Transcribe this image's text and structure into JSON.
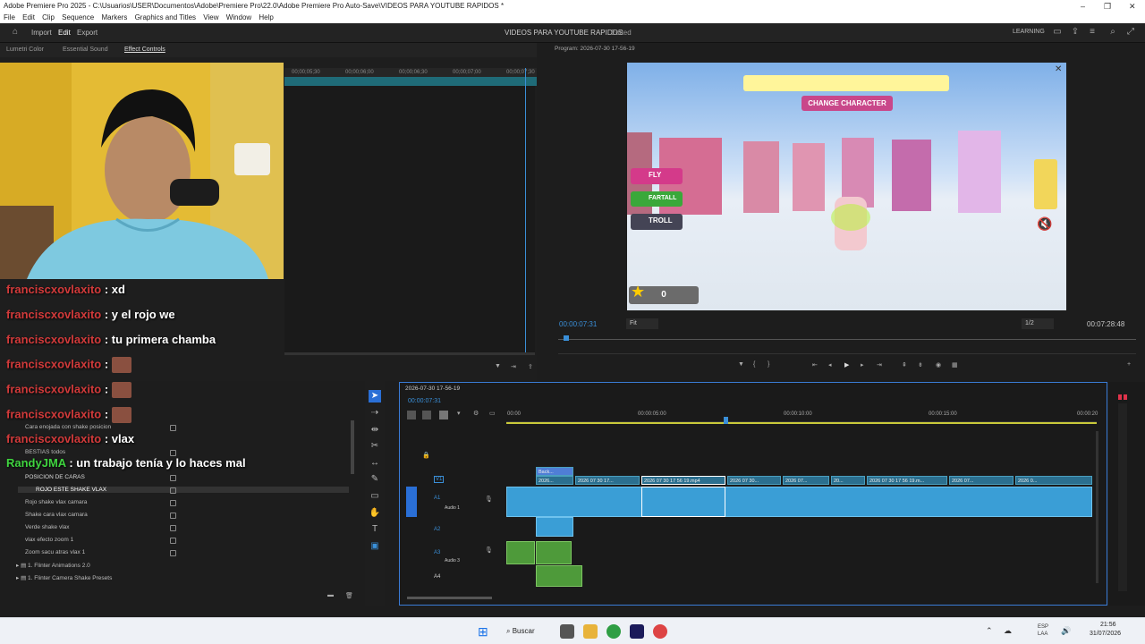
{
  "window": {
    "title": "Adobe Premiere Pro 2025 - C:\\Usuarios\\USER\\Documentos\\Adobe\\Premiere Pro\\22.0\\Adobe Premiere Pro Auto-Save\\VIDEOS PARA YOUTUBE RAPIDOS *",
    "minimize": "–",
    "restore": "❐",
    "close": "✕"
  },
  "menu": [
    "File",
    "Edit",
    "Clip",
    "Sequence",
    "Markers",
    "Graphics and Titles",
    "View",
    "Window",
    "Help"
  ],
  "header": {
    "home_icon": "home-icon",
    "import": "Import",
    "edit": "Edit",
    "export": "Export",
    "project_title": "VIDEOS PARA YOUTUBE RAPIDOS",
    "project_edited": "Edited",
    "learning": "LEARNING"
  },
  "left_tabs": {
    "lumetri": "Lumetri Color",
    "essential_sound": "Essential Sound",
    "effect_controls": "Effect Controls"
  },
  "effect_controls": {
    "ruler": [
      "00;00;05;30",
      "00;00;06;00",
      "00;00;06;30",
      "00;00;07;00",
      "00;00;07;30"
    ]
  },
  "chat": [
    {
      "user": "franciscxovlaxito",
      "msg": ": xd",
      "color": "red",
      "emote": false
    },
    {
      "user": "franciscxovlaxito",
      "msg": ": y el rojo we",
      "color": "red",
      "emote": false
    },
    {
      "user": "franciscxovlaxito",
      "msg": ": tu primera chamba",
      "color": "red",
      "emote": false
    },
    {
      "user": "franciscxovlaxito",
      "msg": ":",
      "color": "red",
      "emote": true
    },
    {
      "user": "franciscxovlaxito",
      "msg": ":",
      "color": "red",
      "emote": true
    },
    {
      "user": "franciscxovlaxito",
      "msg": ":",
      "color": "red",
      "emote": true
    },
    {
      "user": "franciscxovlaxito",
      "msg": ": vlax",
      "color": "red",
      "emote": false
    },
    {
      "user": "RandyJMA",
      "msg": ": un trabajo tenía y lo haces mal",
      "color": "green",
      "emote": false
    }
  ],
  "project": {
    "items": [
      "Cara enojada con shake posicion",
      "BESTIAS todos",
      "POSICION DE CARAS",
      "ROJO ESTE SHAKE VLAX",
      "Rojo shake vlax camara",
      "Shake cara vlax camara",
      "Verde shake vlax",
      "vlax efecto zoom 1",
      "Zoom sacu atras vlax 1",
      "1. Flinter Animations 2.0",
      "1. Flinter Camera Shake Presets"
    ]
  },
  "program": {
    "label": "Program: 2026-07-30 17-56-19",
    "timecode": "00:00:07:31",
    "fit": "Fit",
    "quality": "1/2",
    "duration": "00:07:28:48",
    "game": {
      "change_character": "CHANGE CHARACTER",
      "fly": "FLY",
      "fartall": "FARTALL",
      "troll": "TROLL",
      "counter": "0"
    }
  },
  "timeline": {
    "sequence": "2026-07-30 17-56-19",
    "timecode": "00:00:07:31",
    "ruler": [
      "00:00",
      "00:00:05:00",
      "00:00:10:00",
      "00:00:15:00",
      "00:00:20"
    ],
    "tracks": {
      "v1": "V1",
      "a1": "A1",
      "a1_name": "Audio 1",
      "a2": "A2",
      "a3": "A3",
      "a3_name": "Audio 3",
      "a4": "A4"
    },
    "clips": [
      "Back...",
      "2026...",
      "2026 07 30 17...",
      "2026 07 30 17 56 19.mp4",
      "2026 07 30...",
      "2026 07...",
      "20...",
      "2026 07 30 17 56 19.m...",
      "2026 07...",
      "2026 0..."
    ]
  },
  "taskbar": {
    "search": "Buscar",
    "lang": "ESP\nLAA",
    "time": "21:56",
    "date": "31/07/2026"
  }
}
